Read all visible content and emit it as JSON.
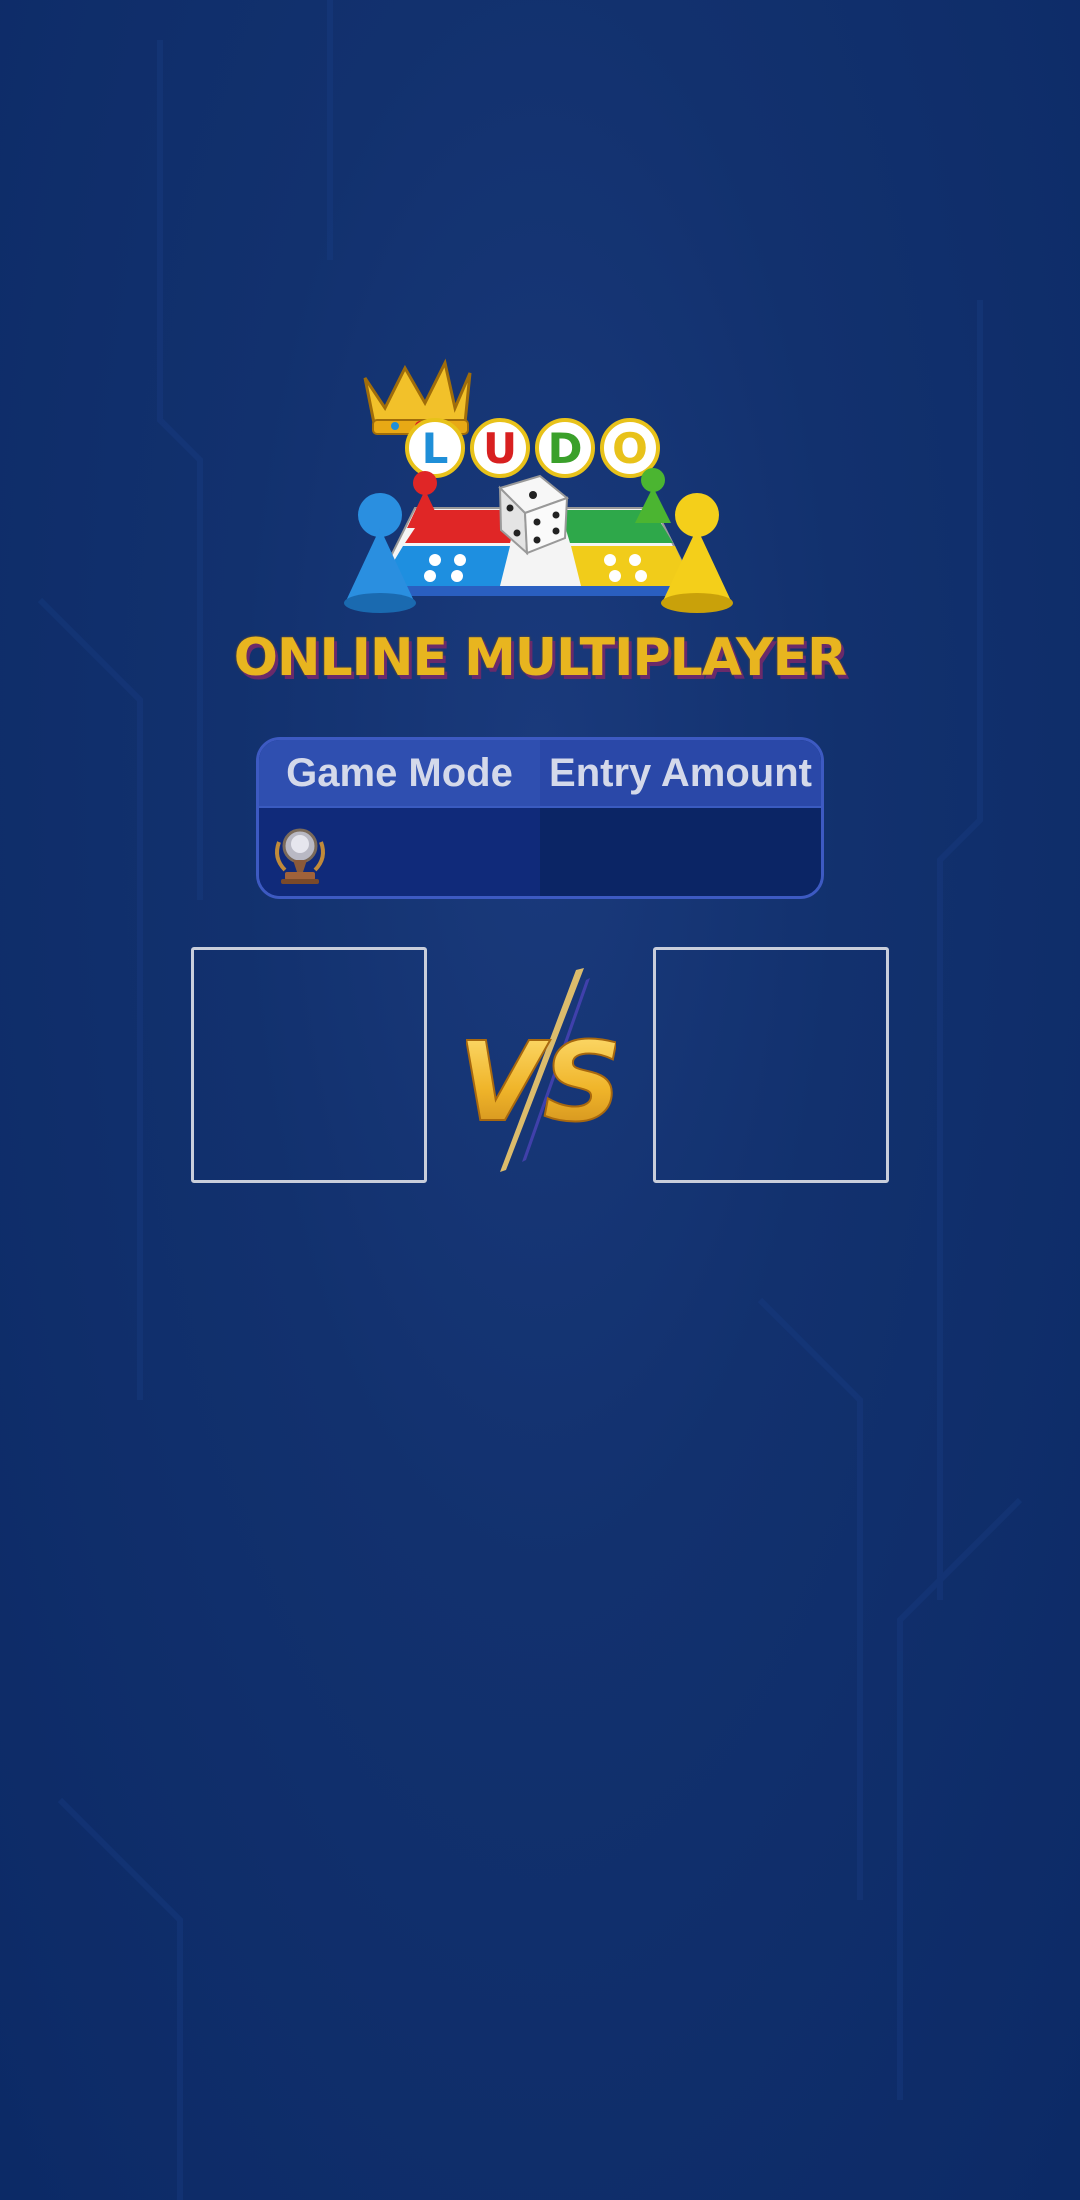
{
  "logo": {
    "letters": [
      "L",
      "U",
      "D",
      "O"
    ],
    "letter_colors": [
      "#1f8fd8",
      "#d82020",
      "#3aa02a",
      "#e8c21a"
    ],
    "icon": "ludo-board-logo-icon"
  },
  "title": "ONLINE MULTIPLAYER",
  "mode_table": {
    "headers": [
      "Game Mode",
      "Entry Amount"
    ],
    "row": {
      "game_mode_icon": "trophy-icon",
      "entry_amount": ""
    }
  },
  "vs_label": "VS",
  "colors": {
    "background": "#12316e",
    "title_gold": "#e8b51f",
    "table_border": "#3d5ac2",
    "header_bg": "#2a48a8",
    "box_border": "#c9cedb"
  }
}
